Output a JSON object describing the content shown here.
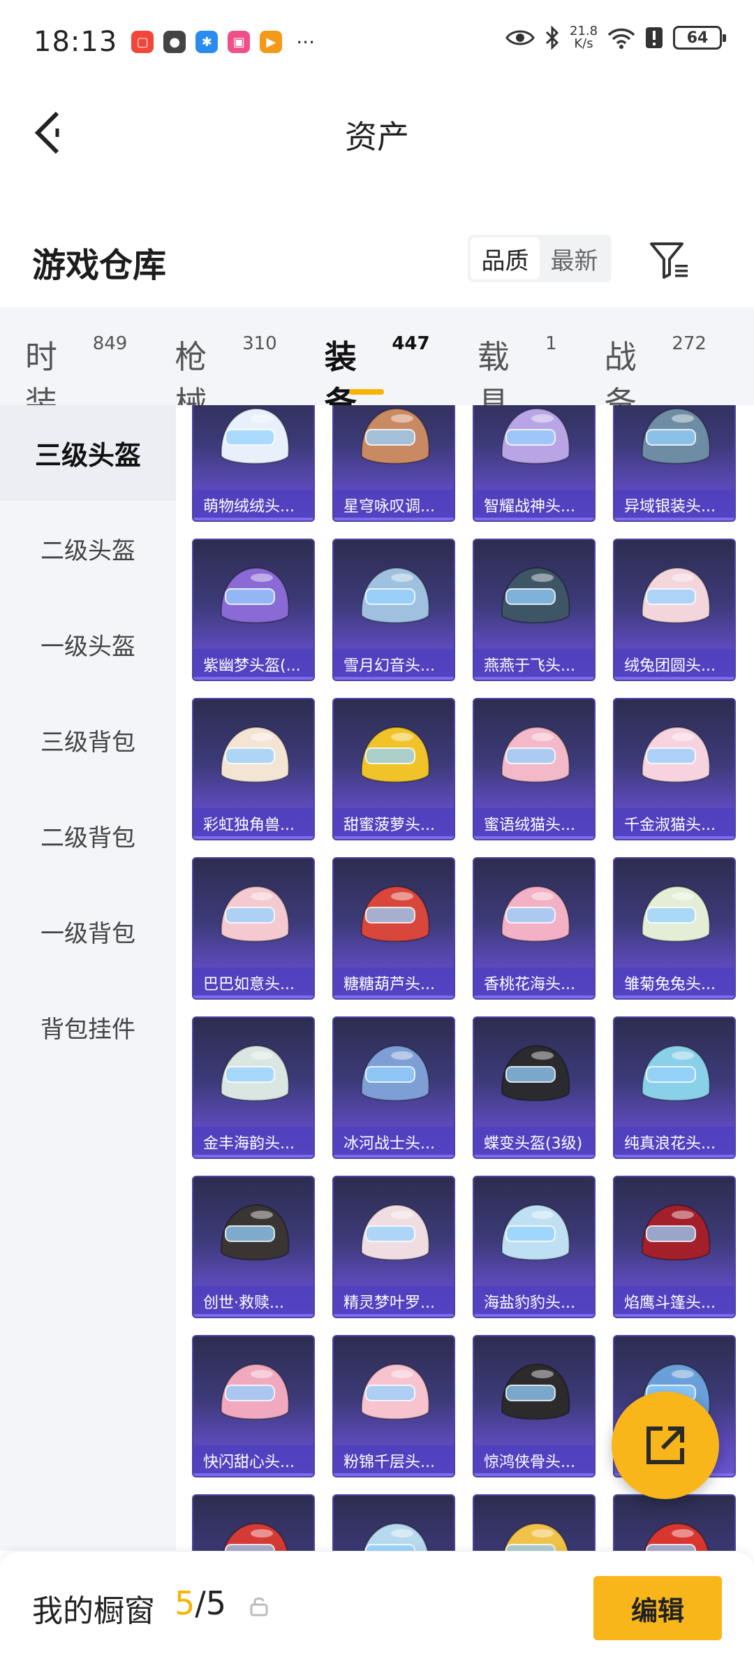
{
  "status_bar": {
    "time": "18:13",
    "net_speed_value": "21.8",
    "net_speed_unit": "K/s",
    "battery": "64",
    "more": "···"
  },
  "header": {
    "title": "资产"
  },
  "warehouse": {
    "title": "游戏仓库",
    "sort_quality": "品质",
    "sort_newest": "最新"
  },
  "categories": [
    {
      "label": "时装",
      "count": "849"
    },
    {
      "label": "枪械",
      "count": "310"
    },
    {
      "label": "装备",
      "count": "447"
    },
    {
      "label": "载具",
      "count": "1"
    },
    {
      "label": "战备",
      "count": "272"
    }
  ],
  "side_nav": [
    "三级头盔",
    "二级头盔",
    "一级头盔",
    "三级背包",
    "二级背包",
    "一级背包",
    "背包挂件"
  ],
  "items": [
    {
      "name": "萌物绒绒头...",
      "color": "#e8f1fb"
    },
    {
      "name": "星穹咏叹调...",
      "color": "#c98a63"
    },
    {
      "name": "智耀战神头...",
      "color": "#b9a4e6"
    },
    {
      "name": "异域银装头...",
      "color": "#6e8da5"
    },
    {
      "name": "紫幽梦头盔(...",
      "color": "#8a6ad4"
    },
    {
      "name": "雪月幻音头...",
      "color": "#9fc1df"
    },
    {
      "name": "燕燕于飞头...",
      "color": "#3e5566"
    },
    {
      "name": "绒兔团圆头...",
      "color": "#f3d6dc"
    },
    {
      "name": "彩虹独角兽...",
      "color": "#f4e4d3"
    },
    {
      "name": "甜蜜菠萝头...",
      "color": "#f0c429"
    },
    {
      "name": "蜜语绒猫头...",
      "color": "#f3b9c8"
    },
    {
      "name": "千金淑猫头...",
      "color": "#f6d3df"
    },
    {
      "name": "巴巴如意头...",
      "color": "#f4c9cf"
    },
    {
      "name": "糖糖葫芦头...",
      "color": "#d9473c"
    },
    {
      "name": "香桃花海头...",
      "color": "#f2b1c4"
    },
    {
      "name": "雏菊兔兔头...",
      "color": "#e4eed6"
    },
    {
      "name": "金丰海韵头...",
      "color": "#d9e6e2"
    },
    {
      "name": "冰河战士头...",
      "color": "#7e9ed6"
    },
    {
      "name": "蝶变头盔(3级)",
      "color": "#2b2b2f"
    },
    {
      "name": "纯真浪花头...",
      "color": "#8ad0e8"
    },
    {
      "name": "创世·救赎...",
      "color": "#3a3432"
    },
    {
      "name": "精灵梦叶罗...",
      "color": "#f0dde2"
    },
    {
      "name": "海盐豹豹头...",
      "color": "#bfe0f3"
    },
    {
      "name": "焰鹰斗篷头...",
      "color": "#a3202a"
    },
    {
      "name": "快闪甜心头...",
      "color": "#f0a9be"
    },
    {
      "name": "粉锦千层头...",
      "color": "#f6c3cf"
    },
    {
      "name": "惊鸿侠骨头...",
      "color": "#2d2a2c"
    },
    {
      "name": "",
      "color": "#6a9fd9"
    },
    {
      "name": "",
      "color": "#d53b35"
    },
    {
      "name": "",
      "color": "#b7d9ee"
    },
    {
      "name": "",
      "color": "#f0c24a"
    },
    {
      "name": "",
      "color": "#d8362f"
    }
  ],
  "showcase": {
    "label": "我的橱窗",
    "current": "5",
    "total": "/5",
    "edit_label": "编辑"
  },
  "colors": {
    "accent": "#f6b400",
    "card_top": "#2d2d50",
    "card_bottom": "#6a56d2"
  }
}
